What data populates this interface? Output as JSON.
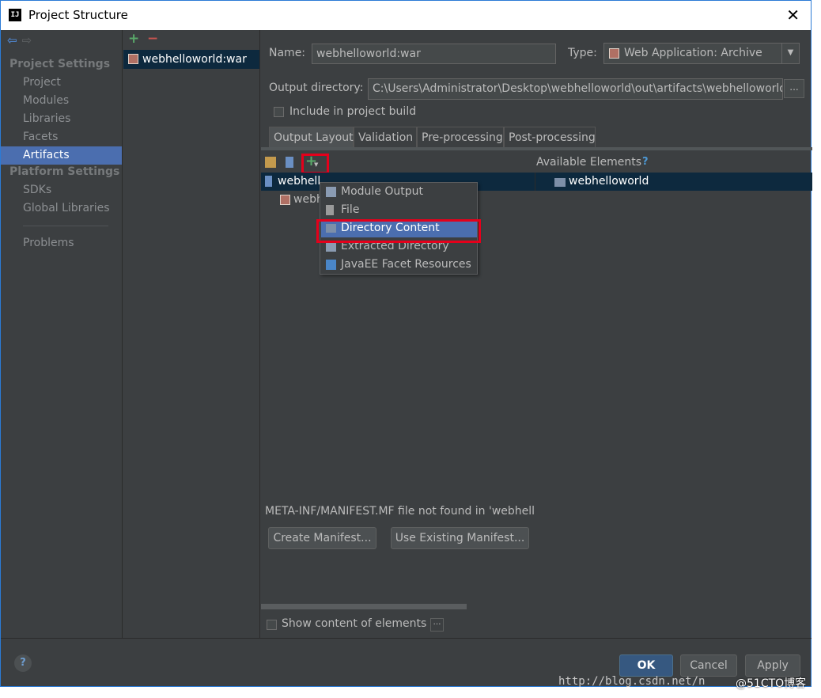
{
  "window": {
    "title": "Project Structure",
    "app_icon_text": "IJ"
  },
  "nav": {
    "sections": [
      {
        "title": "Project Settings",
        "items": [
          "Project",
          "Modules",
          "Libraries",
          "Facets",
          "Artifacts"
        ]
      },
      {
        "title": "Platform Settings",
        "items": [
          "SDKs",
          "Global Libraries"
        ]
      }
    ],
    "problems": "Problems",
    "selected": "Artifacts"
  },
  "artifacts": {
    "items": [
      "webhelloworld:war"
    ]
  },
  "form": {
    "name_label": "Name:",
    "name_value": "webhelloworld:war",
    "type_label": "Type:",
    "type_value": "Web Application: Archive",
    "output_dir_label": "Output directory:",
    "output_dir_value": "C:\\Users\\Administrator\\Desktop\\webhelloworld\\out\\artifacts\\webhelloworld",
    "browse_label": "...",
    "include_build_label": "Include in project build",
    "include_build_checked": false
  },
  "tabs": [
    "Output Layout",
    "Validation",
    "Pre-processing",
    "Post-processing"
  ],
  "active_tab": "Output Layout",
  "layout_tree": {
    "root": "webhell",
    "child": "webh"
  },
  "available": {
    "label": "Available Elements",
    "help": "?",
    "items": [
      "webhelloworld"
    ]
  },
  "add_menu": {
    "items": [
      "Module Output",
      "File",
      "Directory Content",
      "Extracted Directory",
      "JavaEE Facet Resources"
    ],
    "selected": "Directory Content"
  },
  "manifest": {
    "message": "META-INF/MANIFEST.MF file not found in 'webhell",
    "create_label": "Create Manifest...",
    "use_existing_label": "Use Existing Manifest..."
  },
  "show_content_label": "Show content of elements",
  "buttons": {
    "ok": "OK",
    "cancel": "Cancel",
    "apply": "Apply",
    "help": "?"
  },
  "watermark": {
    "url": "http://blog.csdn.net/n",
    "site": "@51CTO博客"
  },
  "colors": {
    "selection": "#4b6eaf",
    "background": "#3c3f41",
    "highlight_box": "#e4001b"
  }
}
